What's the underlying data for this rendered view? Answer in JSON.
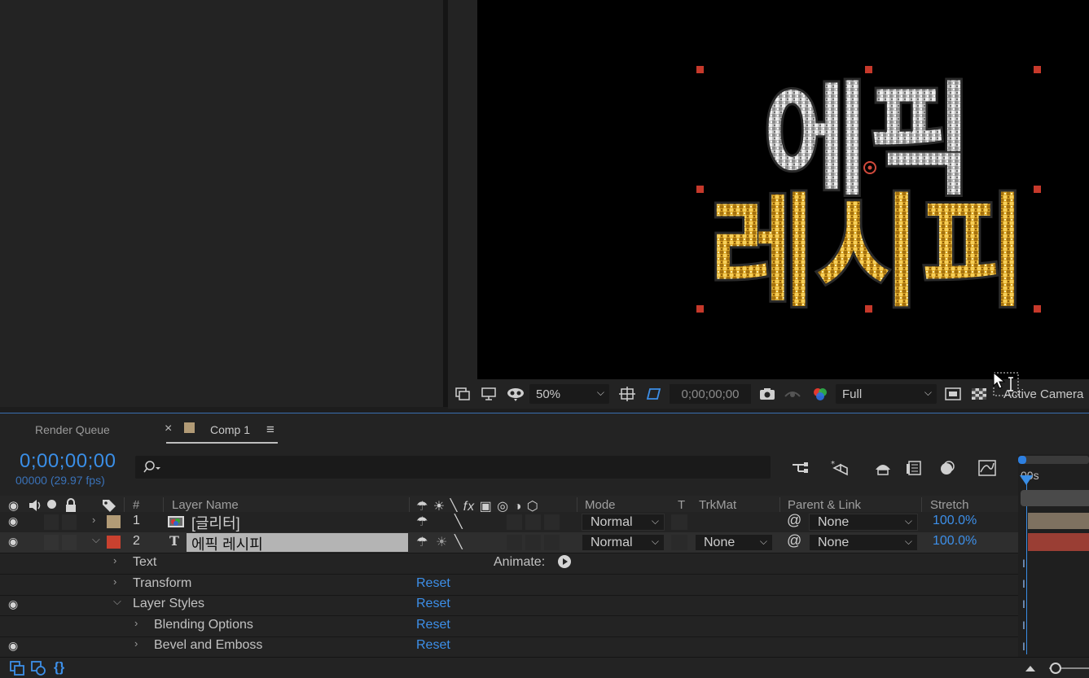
{
  "viewer": {
    "zoom": "50%",
    "timecode": "0;00;00;00",
    "resolution": "Full",
    "camera": "Active Camera"
  },
  "artwork": {
    "top_text": "에픽",
    "bottom_text": "레시피"
  },
  "tabs": {
    "render_queue": "Render Queue",
    "close": "×",
    "comp": "Comp 1",
    "menu": "≡"
  },
  "timeline": {
    "current_time": "0;00;00;00",
    "frames": "00000 (29.97 fps)",
    "ruler_label": "00s",
    "search_placeholder": ""
  },
  "columns": {
    "number": "#",
    "layer_name": "Layer Name",
    "mode": "Mode",
    "t": "T",
    "trkmat": "TrkMat",
    "parent": "Parent & Link",
    "stretch": "Stretch"
  },
  "layers": [
    {
      "index": "1",
      "name": "[글리터]",
      "mode": "Normal",
      "trkmat": "",
      "parent": "None",
      "stretch": "100.0%",
      "label_color": "#b29b76"
    },
    {
      "index": "2",
      "type_glyph": "T",
      "name": "에픽 레시피",
      "mode": "Normal",
      "trkmat": "None",
      "parent": "None",
      "stretch": "100.0%",
      "label_color": "#c9412f"
    }
  ],
  "properties": {
    "text": "Text",
    "animate": "Animate:",
    "transform": "Transform",
    "transform_reset": "Reset",
    "layer_styles": "Layer Styles",
    "layer_styles_reset": "Reset",
    "blending": "Blending Options",
    "blending_reset": "Reset",
    "bevel": "Bevel and Emboss",
    "bevel_reset": "Reset"
  }
}
